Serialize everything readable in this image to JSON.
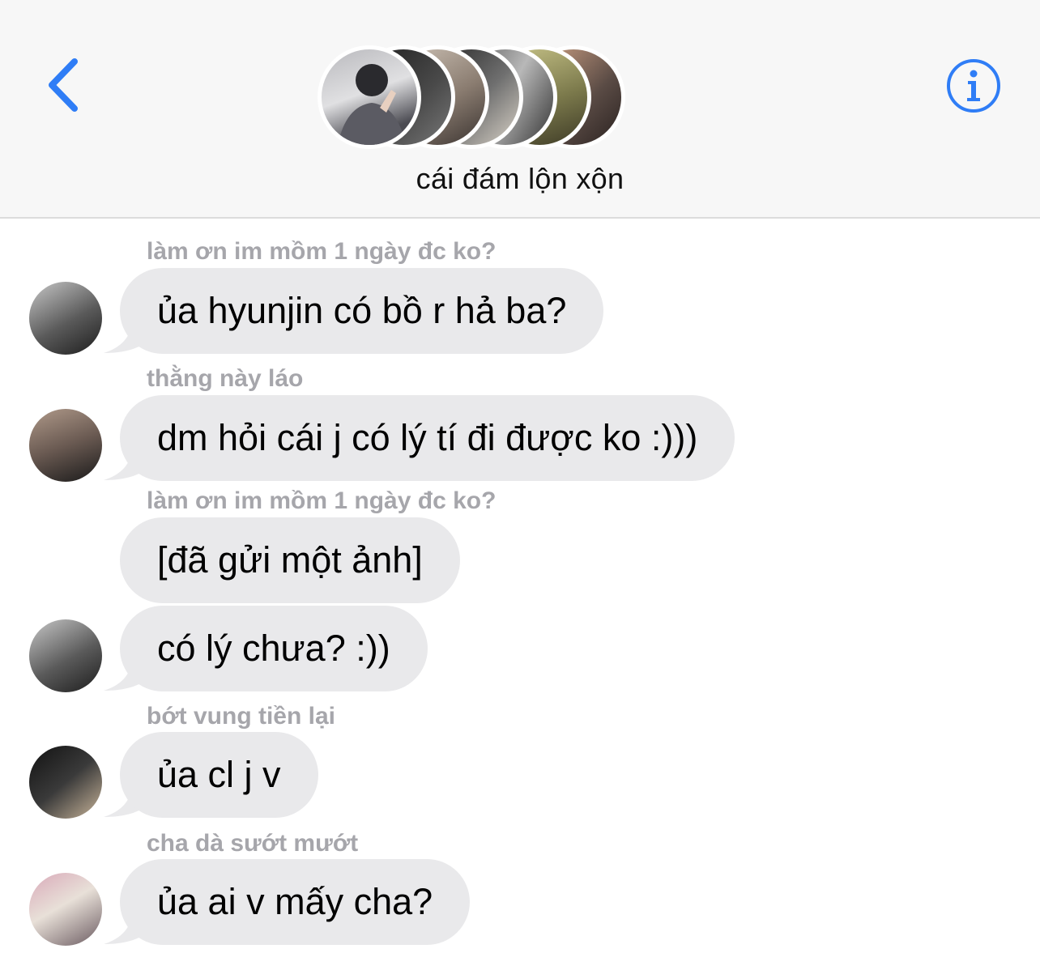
{
  "header": {
    "back_icon": "chevron-left-icon",
    "info_icon": "info-icon",
    "group_name": "cái đám lộn xộn",
    "accent_color": "#2f7df6"
  },
  "messages": [
    {
      "sender": "làm ơn im mồm 1 ngày đc ko?",
      "text": "ủa hyunjin có bồ r hả ba?"
    },
    {
      "sender": "thằng này láo",
      "text": "dm hỏi cái j có lý tí đi được ko :)))"
    },
    {
      "sender": "làm ơn im mồm 1 ngày đc ko?",
      "text": "[đã gửi một ảnh]"
    },
    {
      "sender": "",
      "text": "có lý chưa? :))"
    },
    {
      "sender": "bớt vung tiền lại",
      "text": "ủa cl j v"
    },
    {
      "sender": "cha dà sướt mướt",
      "text": "ủa ai v mấy cha?"
    }
  ],
  "colors": {
    "bubble": "#e9e9eb",
    "sender_label": "#a6a6ab",
    "header_bg": "#f7f7f7"
  }
}
